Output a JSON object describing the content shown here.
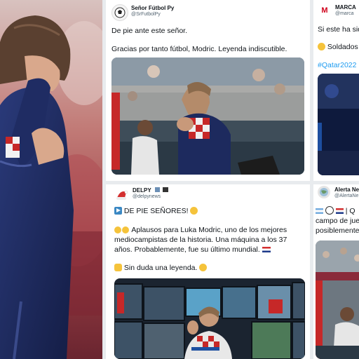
{
  "tweet1": {
    "name": "Señor Fútbol Py",
    "handle": "@SrFutbolPy",
    "line1": "De pie ante este señor.",
    "line2": "Gracias por tanto fútbol, Modric. Leyenda indiscutible."
  },
  "tweet2": {
    "name": "DELPY",
    "handle": "@delpynews",
    "line1": "DE PIE SEÑORES!",
    "line2": "Aplausos para Luka Modric, uno de los mejores",
    "line3": "mediocampistas de la historia. Una máquina a los 37",
    "line4": "años. Probablemente, fue su último mundial.",
    "line5": "Sin duda una leyenda."
  },
  "tweet3": {
    "name": "MARCA",
    "handle": "@marca",
    "line1": "Si este ha sid",
    "line2": "Soldados",
    "hashtag": "#Qatar2022"
  },
  "tweet4": {
    "name": "Alerta Ne",
    "handle": "@AlertaNe",
    "line1": "| Q",
    "line2": "campo de jue",
    "line3": "posiblemente"
  },
  "colors": {
    "croatia_blue": "#1d2a5e",
    "accent": "#1d9bf0",
    "marca_red": "#d0021b"
  }
}
